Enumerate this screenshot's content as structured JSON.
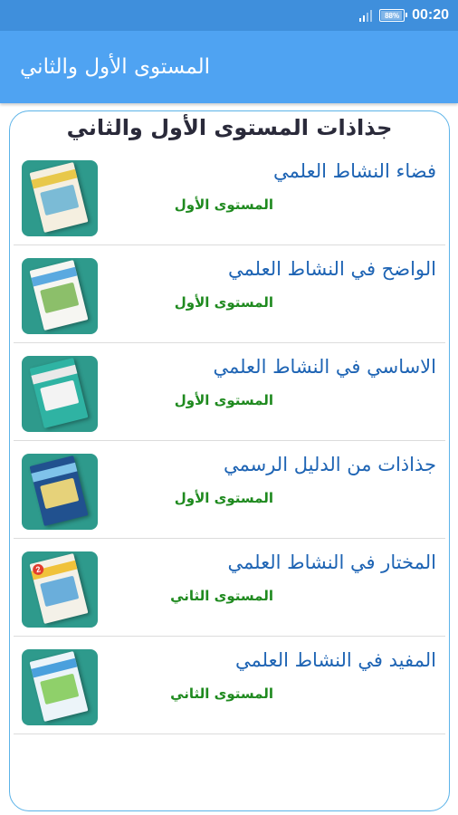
{
  "status_bar": {
    "time": "00:20",
    "battery_text": "88%",
    "battery_level": 0.88,
    "icons": [
      "signal-icon",
      "battery-icon"
    ]
  },
  "app_bar": {
    "title": "المستوى الأول والثاني",
    "color": "#4fa3f2"
  },
  "card": {
    "title": "جذاذات المستوى الأول والثاني",
    "border_color": "#5cb3e8"
  },
  "items": [
    {
      "title": "فضاء النشاط العلمي",
      "level": "المستوى الأول",
      "cover": {
        "bg": "#f5efe0",
        "band": "#e8c84a",
        "pic": "#7bbbd6",
        "badge": ""
      }
    },
    {
      "title": "الواضح في النشاط العلمي",
      "level": "المستوى الأول",
      "cover": {
        "bg": "#f6f6f2",
        "band": "#5aa9e0",
        "pic": "#8cbf6a",
        "badge": ""
      }
    },
    {
      "title": "الاساسي في النشاط العلمي",
      "level": "المستوى الأول",
      "cover": {
        "bg": "#2fb3a3",
        "band": "#e9e9e9",
        "pic": "#f3f3f3",
        "badge": ""
      }
    },
    {
      "title": "جذاذات من الدليل الرسمي",
      "level": "المستوى الأول",
      "cover": {
        "bg": "#21518f",
        "band": "#7fc3ea",
        "pic": "#e6d27a",
        "badge": ""
      }
    },
    {
      "title": "المختار في النشاط العلمي",
      "level": "المستوى الثاني",
      "cover": {
        "bg": "#f4f1e8",
        "band": "#f0c23a",
        "pic": "#6aaedb",
        "badge": "2"
      }
    },
    {
      "title": "المفيد في النشاط العلمي",
      "level": "المستوى الثاني",
      "cover": {
        "bg": "#ecf4f9",
        "band": "#4aa0dd",
        "pic": "#8fd06a",
        "badge": ""
      }
    }
  ],
  "colors": {
    "item_title": "#1e64b4",
    "item_level": "#1f8a1f",
    "thumb_bg": "#2e9a8c"
  }
}
